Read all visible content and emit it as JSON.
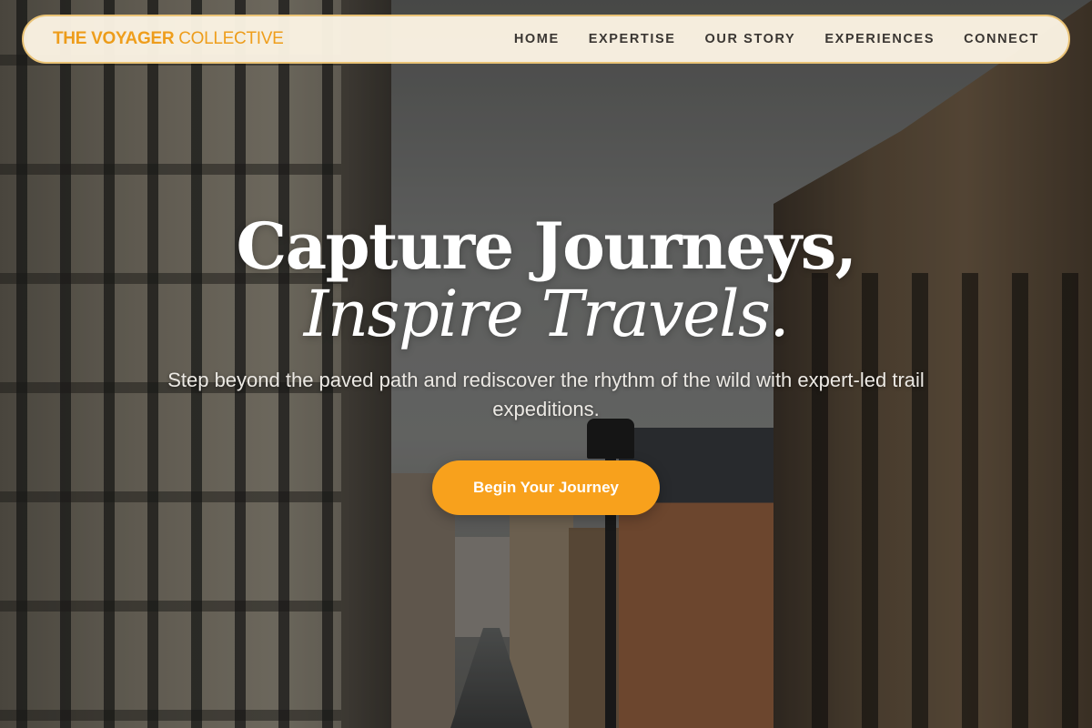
{
  "brand": {
    "part1": "THE VOYAGER",
    "part2": "COLLECTIVE"
  },
  "nav": {
    "items": [
      {
        "label": "HOME"
      },
      {
        "label": "EXPERTISE"
      },
      {
        "label": "OUR STORY"
      },
      {
        "label": "EXPERIENCES"
      },
      {
        "label": "CONNECT"
      }
    ]
  },
  "hero": {
    "headline_line1": "Capture Journeys,",
    "headline_line2": "Inspire Travels.",
    "subtext": "Step beyond the paved path and rediscover the rhythm of the wild with expert-led trail expeditions.",
    "cta_label": "Begin Your Journey"
  },
  "colors": {
    "accent": "#f8a11c",
    "nav_background": "#fcf4e4",
    "nav_border": "#f1c878",
    "nav_text": "#3a3632"
  }
}
